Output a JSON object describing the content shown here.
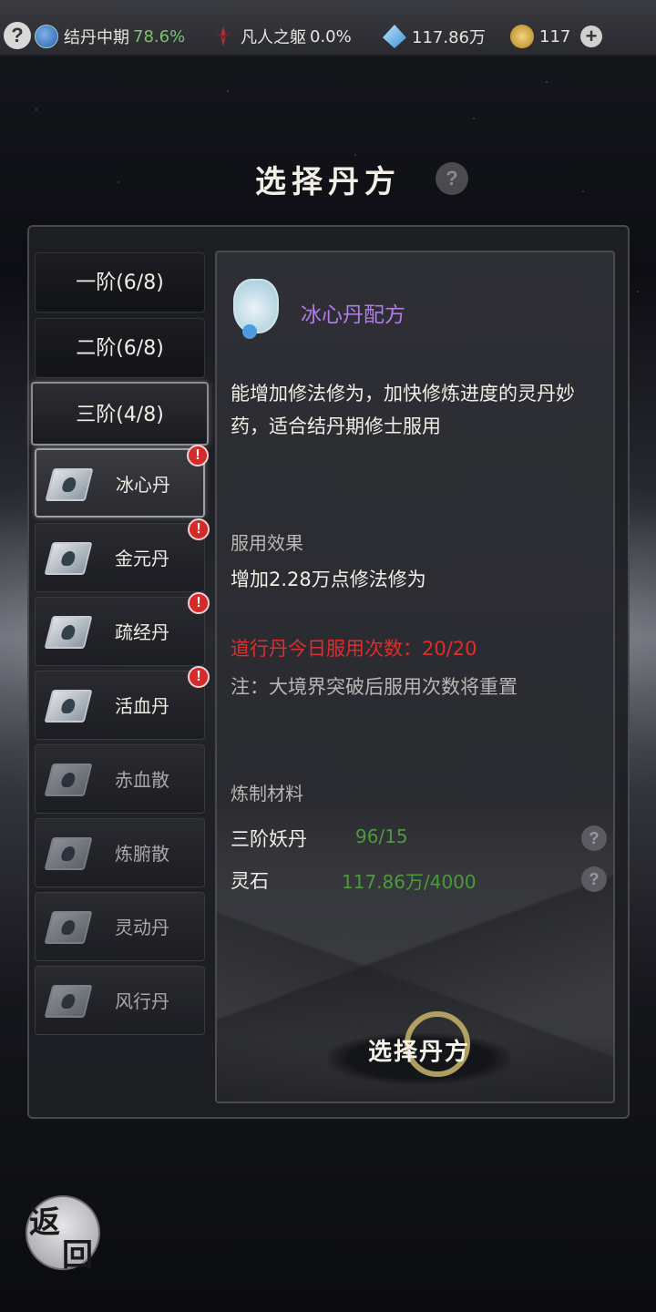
{
  "topbar": {
    "help_glyph": "?",
    "realm_label": "结丹中期",
    "realm_progress": "78.6%",
    "body_label": "凡人之躯",
    "body_progress": "0.0%",
    "spirit_stone": "117.86万",
    "coin": "117",
    "plus_glyph": "+"
  },
  "page": {
    "title": "选择丹方",
    "help_glyph": "?"
  },
  "tiers": [
    {
      "label": "一阶(6/8)"
    },
    {
      "label": "二阶(6/8)"
    },
    {
      "label": "三阶(4/8)",
      "active": true
    }
  ],
  "recipes": [
    {
      "name": "冰心丹",
      "selected": true,
      "alert": true
    },
    {
      "name": "金元丹",
      "alert": true
    },
    {
      "name": "疏经丹",
      "alert": true
    },
    {
      "name": "活血丹",
      "alert": true
    },
    {
      "name": "赤血散",
      "dim": true
    },
    {
      "name": "炼腑散",
      "dim": true
    },
    {
      "name": "灵动丹",
      "dim": true
    },
    {
      "name": "风行丹",
      "dim": true
    }
  ],
  "alert_glyph": "!",
  "detail": {
    "title": "冰心丹配方",
    "description": "能增加修法修为，加快修炼进度的灵丹妙药，适合结丹期修士服用",
    "effect_label": "服用效果",
    "effect_text": "增加2.28万点修法修为",
    "limit_text": "道行丹今日服用次数：20/20",
    "note_text": "注：大境界突破后服用次数将重置",
    "materials_label": "炼制材料",
    "materials": [
      {
        "name": "三阶妖丹",
        "qty": "96/15"
      },
      {
        "name": "灵石",
        "qty": "117.86万/4000"
      }
    ],
    "help_glyph": "?",
    "select_button": "选择丹方"
  },
  "back": {
    "char1": "返",
    "char2": "回"
  },
  "colors": {
    "accent_purple": "#b07ce8",
    "warning_red": "#e02c2c",
    "ok_green": "#4d9a3c",
    "progress_green": "#7fc26a"
  }
}
